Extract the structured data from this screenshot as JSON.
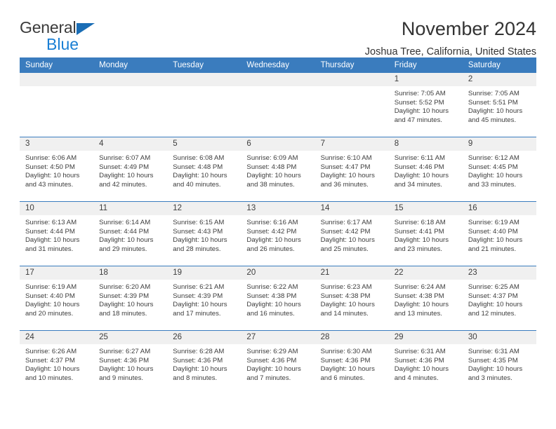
{
  "logo": {
    "word1": "General",
    "word2": "Blue",
    "triangle_color": "#1a6db5",
    "word2_color": "#1a7fd4"
  },
  "header": {
    "title": "November 2024",
    "subtitle": "Joshua Tree, California, United States"
  },
  "calendar": {
    "header_bg": "#3a7cbe",
    "daynum_bg": "#f0f0f0",
    "weekdays": [
      "Sunday",
      "Monday",
      "Tuesday",
      "Wednesday",
      "Thursday",
      "Friday",
      "Saturday"
    ],
    "weeks": [
      [
        {
          "day": "",
          "empty": true,
          "sunrise": "",
          "sunset": "",
          "daylight1": "",
          "daylight2": ""
        },
        {
          "day": "",
          "empty": true,
          "sunrise": "",
          "sunset": "",
          "daylight1": "",
          "daylight2": ""
        },
        {
          "day": "",
          "empty": true,
          "sunrise": "",
          "sunset": "",
          "daylight1": "",
          "daylight2": ""
        },
        {
          "day": "",
          "empty": true,
          "sunrise": "",
          "sunset": "",
          "daylight1": "",
          "daylight2": ""
        },
        {
          "day": "",
          "empty": true,
          "sunrise": "",
          "sunset": "",
          "daylight1": "",
          "daylight2": ""
        },
        {
          "day": "1",
          "sunrise": "Sunrise: 7:05 AM",
          "sunset": "Sunset: 5:52 PM",
          "daylight1": "Daylight: 10 hours",
          "daylight2": "and 47 minutes."
        },
        {
          "day": "2",
          "sunrise": "Sunrise: 7:05 AM",
          "sunset": "Sunset: 5:51 PM",
          "daylight1": "Daylight: 10 hours",
          "daylight2": "and 45 minutes."
        }
      ],
      [
        {
          "day": "3",
          "sunrise": "Sunrise: 6:06 AM",
          "sunset": "Sunset: 4:50 PM",
          "daylight1": "Daylight: 10 hours",
          "daylight2": "and 43 minutes."
        },
        {
          "day": "4",
          "sunrise": "Sunrise: 6:07 AM",
          "sunset": "Sunset: 4:49 PM",
          "daylight1": "Daylight: 10 hours",
          "daylight2": "and 42 minutes."
        },
        {
          "day": "5",
          "sunrise": "Sunrise: 6:08 AM",
          "sunset": "Sunset: 4:48 PM",
          "daylight1": "Daylight: 10 hours",
          "daylight2": "and 40 minutes."
        },
        {
          "day": "6",
          "sunrise": "Sunrise: 6:09 AM",
          "sunset": "Sunset: 4:48 PM",
          "daylight1": "Daylight: 10 hours",
          "daylight2": "and 38 minutes."
        },
        {
          "day": "7",
          "sunrise": "Sunrise: 6:10 AM",
          "sunset": "Sunset: 4:47 PM",
          "daylight1": "Daylight: 10 hours",
          "daylight2": "and 36 minutes."
        },
        {
          "day": "8",
          "sunrise": "Sunrise: 6:11 AM",
          "sunset": "Sunset: 4:46 PM",
          "daylight1": "Daylight: 10 hours",
          "daylight2": "and 34 minutes."
        },
        {
          "day": "9",
          "sunrise": "Sunrise: 6:12 AM",
          "sunset": "Sunset: 4:45 PM",
          "daylight1": "Daylight: 10 hours",
          "daylight2": "and 33 minutes."
        }
      ],
      [
        {
          "day": "10",
          "sunrise": "Sunrise: 6:13 AM",
          "sunset": "Sunset: 4:44 PM",
          "daylight1": "Daylight: 10 hours",
          "daylight2": "and 31 minutes."
        },
        {
          "day": "11",
          "sunrise": "Sunrise: 6:14 AM",
          "sunset": "Sunset: 4:44 PM",
          "daylight1": "Daylight: 10 hours",
          "daylight2": "and 29 minutes."
        },
        {
          "day": "12",
          "sunrise": "Sunrise: 6:15 AM",
          "sunset": "Sunset: 4:43 PM",
          "daylight1": "Daylight: 10 hours",
          "daylight2": "and 28 minutes."
        },
        {
          "day": "13",
          "sunrise": "Sunrise: 6:16 AM",
          "sunset": "Sunset: 4:42 PM",
          "daylight1": "Daylight: 10 hours",
          "daylight2": "and 26 minutes."
        },
        {
          "day": "14",
          "sunrise": "Sunrise: 6:17 AM",
          "sunset": "Sunset: 4:42 PM",
          "daylight1": "Daylight: 10 hours",
          "daylight2": "and 25 minutes."
        },
        {
          "day": "15",
          "sunrise": "Sunrise: 6:18 AM",
          "sunset": "Sunset: 4:41 PM",
          "daylight1": "Daylight: 10 hours",
          "daylight2": "and 23 minutes."
        },
        {
          "day": "16",
          "sunrise": "Sunrise: 6:19 AM",
          "sunset": "Sunset: 4:40 PM",
          "daylight1": "Daylight: 10 hours",
          "daylight2": "and 21 minutes."
        }
      ],
      [
        {
          "day": "17",
          "sunrise": "Sunrise: 6:19 AM",
          "sunset": "Sunset: 4:40 PM",
          "daylight1": "Daylight: 10 hours",
          "daylight2": "and 20 minutes."
        },
        {
          "day": "18",
          "sunrise": "Sunrise: 6:20 AM",
          "sunset": "Sunset: 4:39 PM",
          "daylight1": "Daylight: 10 hours",
          "daylight2": "and 18 minutes."
        },
        {
          "day": "19",
          "sunrise": "Sunrise: 6:21 AM",
          "sunset": "Sunset: 4:39 PM",
          "daylight1": "Daylight: 10 hours",
          "daylight2": "and 17 minutes."
        },
        {
          "day": "20",
          "sunrise": "Sunrise: 6:22 AM",
          "sunset": "Sunset: 4:38 PM",
          "daylight1": "Daylight: 10 hours",
          "daylight2": "and 16 minutes."
        },
        {
          "day": "21",
          "sunrise": "Sunrise: 6:23 AM",
          "sunset": "Sunset: 4:38 PM",
          "daylight1": "Daylight: 10 hours",
          "daylight2": "and 14 minutes."
        },
        {
          "day": "22",
          "sunrise": "Sunrise: 6:24 AM",
          "sunset": "Sunset: 4:38 PM",
          "daylight1": "Daylight: 10 hours",
          "daylight2": "and 13 minutes."
        },
        {
          "day": "23",
          "sunrise": "Sunrise: 6:25 AM",
          "sunset": "Sunset: 4:37 PM",
          "daylight1": "Daylight: 10 hours",
          "daylight2": "and 12 minutes."
        }
      ],
      [
        {
          "day": "24",
          "sunrise": "Sunrise: 6:26 AM",
          "sunset": "Sunset: 4:37 PM",
          "daylight1": "Daylight: 10 hours",
          "daylight2": "and 10 minutes."
        },
        {
          "day": "25",
          "sunrise": "Sunrise: 6:27 AM",
          "sunset": "Sunset: 4:36 PM",
          "daylight1": "Daylight: 10 hours",
          "daylight2": "and 9 minutes."
        },
        {
          "day": "26",
          "sunrise": "Sunrise: 6:28 AM",
          "sunset": "Sunset: 4:36 PM",
          "daylight1": "Daylight: 10 hours",
          "daylight2": "and 8 minutes."
        },
        {
          "day": "27",
          "sunrise": "Sunrise: 6:29 AM",
          "sunset": "Sunset: 4:36 PM",
          "daylight1": "Daylight: 10 hours",
          "daylight2": "and 7 minutes."
        },
        {
          "day": "28",
          "sunrise": "Sunrise: 6:30 AM",
          "sunset": "Sunset: 4:36 PM",
          "daylight1": "Daylight: 10 hours",
          "daylight2": "and 6 minutes."
        },
        {
          "day": "29",
          "sunrise": "Sunrise: 6:31 AM",
          "sunset": "Sunset: 4:36 PM",
          "daylight1": "Daylight: 10 hours",
          "daylight2": "and 4 minutes."
        },
        {
          "day": "30",
          "sunrise": "Sunrise: 6:31 AM",
          "sunset": "Sunset: 4:35 PM",
          "daylight1": "Daylight: 10 hours",
          "daylight2": "and 3 minutes."
        }
      ]
    ]
  }
}
